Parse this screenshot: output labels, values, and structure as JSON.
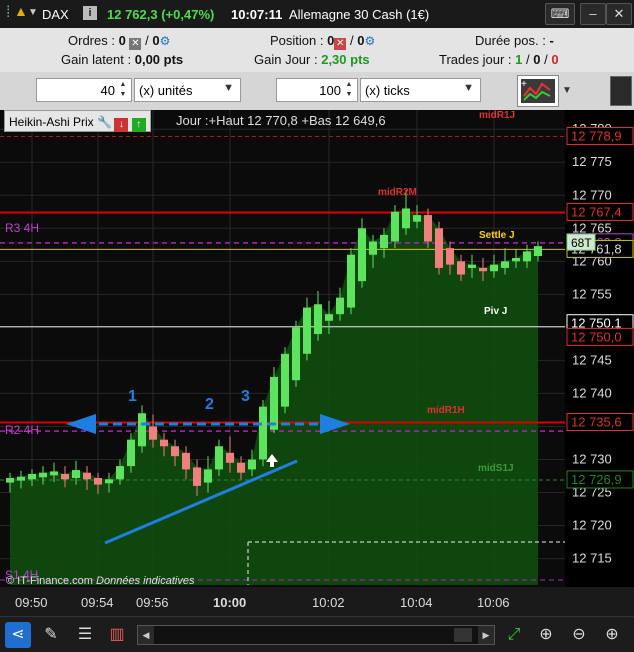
{
  "titlebar": {
    "symbol": "DAX",
    "info_icon": "info-icon",
    "price_change": "12 762,3 (+0,47%)",
    "time": "10:07:11",
    "market": "Allemagne 30 Cash (1€)",
    "keyboard_icon": "keyboard-icon",
    "minimize_label": "‒",
    "close_label": "✕"
  },
  "info": {
    "orders_label": "Ordres :",
    "orders_a": "0",
    "orders_b": "0",
    "position_label": "Position :",
    "position_a": "0",
    "position_b": "0",
    "duration_label": "Durée pos. :",
    "duration_value": "-",
    "latent_label": "Gain latent :",
    "latent_value": "0,00 pts",
    "day_label": "Gain Jour :",
    "day_value": "2,30 pts",
    "trades_label": "Trades jour :",
    "trades_a": "1",
    "trades_b": "0",
    "trades_c": "0",
    "sep": "/"
  },
  "toolbar": {
    "qty_value": "40",
    "qty_unit": "(x) unités",
    "ticks_value": "100",
    "ticks_unit": "(x) ticks"
  },
  "chart_header": {
    "title": "Heikin-Ashi Prix",
    "summary": "Jour :+Haut 12 770,8 +Bas 12 649,6"
  },
  "chart_labels": {
    "r3": "R3 4H",
    "r2": "R2 4H",
    "s1": "S1 4H",
    "midR1J": "midR1J",
    "midR2M": "midR2M",
    "settleJ": "Settle J",
    "pivJ": "Piv J",
    "midR1H": "midR1H",
    "midS1J": "midS1J",
    "ann1": "1",
    "ann2": "2",
    "ann3": "3",
    "credit_a": "© IT-Finance.com",
    "credit_b": "Données indicatives"
  },
  "price_tags": {
    "t1": "12 778,9",
    "t2": "12 767,4",
    "t3": "12 762,8",
    "t4": "12 761,8",
    "t5": "12 750,1",
    "t6": "12 750,0",
    "t7": "12 735,6",
    "t8": "12 726,9",
    "count": "68T"
  },
  "colors": {
    "bull": "#5ee35e",
    "bear": "#f07f7f",
    "resistance": "#e00000",
    "pivot_violet": "#b020c0",
    "tag_red": "#e03030",
    "tag_green": "#1d8a1d",
    "annotation_blue": "#1e7fe0"
  },
  "chart_data": {
    "type": "candlestick",
    "title": "Heikin-Ashi Prix",
    "y_ticks": [
      12715,
      12720,
      12725,
      12730,
      12735,
      12740,
      12745,
      12750,
      12755,
      12760,
      12765,
      12770,
      12775,
      12780
    ],
    "y_tick_labels": [
      "12 715",
      "12 720",
      "12 725",
      "12 730",
      "12 735",
      "12 740",
      "12 745",
      "12 750",
      "12 755",
      "12 760",
      "12 765",
      "12 770",
      "12 775",
      "12 780"
    ],
    "ylim": [
      12711,
      12782
    ],
    "x_tick_labels": [
      "09:50",
      "09:54",
      "09:56",
      "10:00",
      "10:02",
      "10:04",
      "10:06"
    ],
    "x_tick_candle_index": [
      2,
      8,
      13,
      20,
      29,
      37,
      44
    ],
    "levels": [
      {
        "name": "midR1J",
        "value": 12778.9,
        "style": "dashed-red"
      },
      {
        "name": "midR2M",
        "value": 12767.4,
        "style": "solid-red"
      },
      {
        "name": "R3 4H",
        "value": 12762.8,
        "style": "dashed-violet"
      },
      {
        "name": "Settle J",
        "value": 12761.8,
        "style": "solid-yellow"
      },
      {
        "name": "Piv J",
        "value": 12750.1,
        "style": "solid-white"
      },
      {
        "name": "midR1H",
        "value": 12735.6,
        "style": "solid-red"
      },
      {
        "name": "R2 4H",
        "value": 12734.3,
        "style": "dashed-violet"
      },
      {
        "name": "midS1J",
        "value": 12726.9,
        "style": "dashed-green"
      }
    ],
    "candles": [
      {
        "o": 12726.5,
        "c": 12727.2,
        "h": 12728.0,
        "l": 12725.0
      },
      {
        "o": 12726.8,
        "c": 12727.4,
        "h": 12728.3,
        "l": 12725.6
      },
      {
        "o": 12727.0,
        "c": 12727.8,
        "h": 12728.5,
        "l": 12726.0
      },
      {
        "o": 12727.3,
        "c": 12728.0,
        "h": 12729.0,
        "l": 12726.2
      },
      {
        "o": 12727.6,
        "c": 12728.2,
        "h": 12729.5,
        "l": 12726.6
      },
      {
        "o": 12727.8,
        "c": 12727.0,
        "h": 12729.0,
        "l": 12725.8
      },
      {
        "o": 12727.2,
        "c": 12728.4,
        "h": 12729.8,
        "l": 12726.2
      },
      {
        "o": 12728.0,
        "c": 12727.0,
        "h": 12729.0,
        "l": 12725.4
      },
      {
        "o": 12727.2,
        "c": 12726.2,
        "h": 12728.0,
        "l": 12724.8
      },
      {
        "o": 12726.4,
        "c": 12727.0,
        "h": 12728.0,
        "l": 12725.0
      },
      {
        "o": 12727.0,
        "c": 12729.0,
        "h": 12730.0,
        "l": 12726.2
      },
      {
        "o": 12729.0,
        "c": 12733.0,
        "h": 12734.0,
        "l": 12728.0
      },
      {
        "o": 12732.0,
        "c": 12737.0,
        "h": 12738.2,
        "l": 12731.0
      },
      {
        "o": 12735.0,
        "c": 12733.0,
        "h": 12736.8,
        "l": 12731.8
      },
      {
        "o": 12733.0,
        "c": 12732.0,
        "h": 12734.0,
        "l": 12730.5
      },
      {
        "o": 12732.0,
        "c": 12730.5,
        "h": 12733.0,
        "l": 12729.0
      },
      {
        "o": 12731.0,
        "c": 12728.5,
        "h": 12732.0,
        "l": 12727.0
      },
      {
        "o": 12728.8,
        "c": 12726.0,
        "h": 12730.0,
        "l": 12724.5
      },
      {
        "o": 12726.5,
        "c": 12728.5,
        "h": 12730.5,
        "l": 12725.0
      },
      {
        "o": 12728.5,
        "c": 12732.0,
        "h": 12733.0,
        "l": 12727.5
      },
      {
        "o": 12731.0,
        "c": 12729.5,
        "h": 12733.5,
        "l": 12728.0
      },
      {
        "o": 12729.5,
        "c": 12728.0,
        "h": 12730.5,
        "l": 12727.0
      },
      {
        "o": 12728.5,
        "c": 12730.0,
        "h": 12731.5,
        "l": 12727.5
      },
      {
        "o": 12730.0,
        "c": 12738.0,
        "h": 12739.0,
        "l": 12729.0
      },
      {
        "o": 12734.5,
        "c": 12742.5,
        "h": 12744.0,
        "l": 12734.0
      },
      {
        "o": 12738.0,
        "c": 12746.0,
        "h": 12747.0,
        "l": 12737.0
      },
      {
        "o": 12742.0,
        "c": 12750.0,
        "h": 12751.0,
        "l": 12741.0
      },
      {
        "o": 12746.0,
        "c": 12753.0,
        "h": 12754.5,
        "l": 12745.0
      },
      {
        "o": 12749.0,
        "c": 12753.5,
        "h": 12755.5,
        "l": 12748.0
      },
      {
        "o": 12751.0,
        "c": 12752.0,
        "h": 12754.0,
        "l": 12749.0
      },
      {
        "o": 12752.0,
        "c": 12754.5,
        "h": 12756.0,
        "l": 12751.0
      },
      {
        "o": 12753.0,
        "c": 12761.0,
        "h": 12762.0,
        "l": 12752.0
      },
      {
        "o": 12757.0,
        "c": 12765.0,
        "h": 12766.5,
        "l": 12756.0
      },
      {
        "o": 12761.0,
        "c": 12763.0,
        "h": 12764.0,
        "l": 12759.0
      },
      {
        "o": 12762.0,
        "c": 12764.0,
        "h": 12765.0,
        "l": 12760.5
      },
      {
        "o": 12763.0,
        "c": 12767.5,
        "h": 12768.5,
        "l": 12762.0
      },
      {
        "o": 12765.0,
        "c": 12768.0,
        "h": 12770.8,
        "l": 12764.0
      },
      {
        "o": 12766.0,
        "c": 12767.0,
        "h": 12768.5,
        "l": 12765.0
      },
      {
        "o": 12767.0,
        "c": 12763.0,
        "h": 12768.0,
        "l": 12762.0
      },
      {
        "o": 12765.0,
        "c": 12759.0,
        "h": 12766.0,
        "l": 12758.0
      },
      {
        "o": 12762.0,
        "c": 12759.5,
        "h": 12763.0,
        "l": 12758.0
      },
      {
        "o": 12760.0,
        "c": 12758.0,
        "h": 12761.0,
        "l": 12757.0
      },
      {
        "o": 12759.0,
        "c": 12759.5,
        "h": 12761.0,
        "l": 12757.5
      },
      {
        "o": 12759.0,
        "c": 12758.5,
        "h": 12760.5,
        "l": 12757.0
      },
      {
        "o": 12758.5,
        "c": 12759.5,
        "h": 12761.0,
        "l": 12757.5
      },
      {
        "o": 12759.0,
        "c": 12760.0,
        "h": 12762.0,
        "l": 12758.0
      },
      {
        "o": 12760.0,
        "c": 12760.5,
        "h": 12761.8,
        "l": 12759.0
      },
      {
        "o": 12760.0,
        "c": 12761.5,
        "h": 12762.5,
        "l": 12759.0
      },
      {
        "o": 12760.8,
        "c": 12762.3,
        "h": 12763.0,
        "l": 12760.0
      }
    ]
  }
}
